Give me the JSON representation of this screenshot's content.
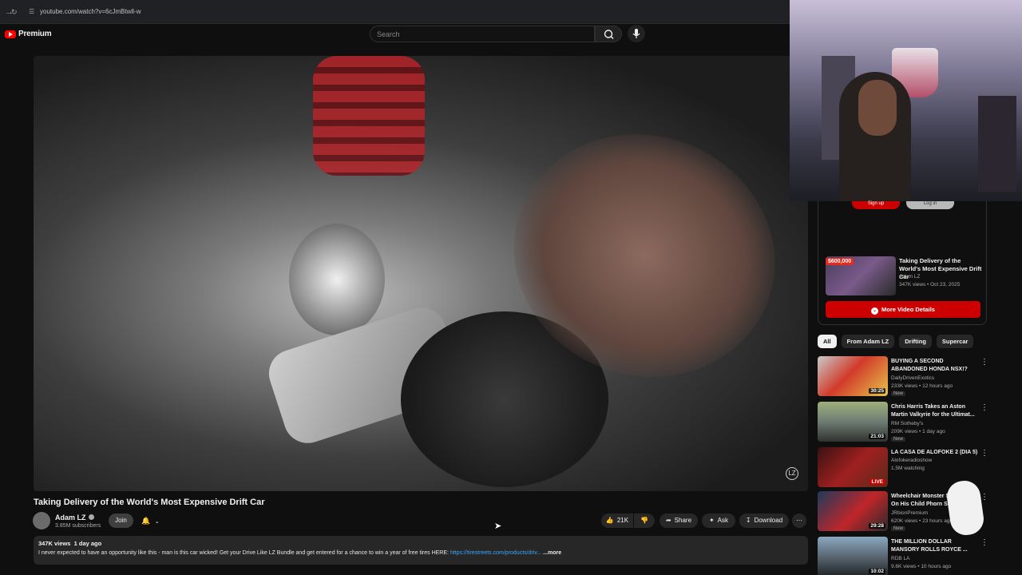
{
  "browser": {
    "url": "youtube.com/watch?v=6cJmBtwll-w"
  },
  "header": {
    "logo_text": "Premium",
    "search_placeholder": "Search"
  },
  "video": {
    "title": "Taking Delivery of the World's Most Expensive Drift Car",
    "watermark": "LZ"
  },
  "channel": {
    "name": "Adam LZ",
    "subscribers": "3.85M subscribers",
    "join_label": "Join"
  },
  "actions": {
    "likes": "21K",
    "share": "Share",
    "ask": "Ask",
    "download": "Download"
  },
  "description": {
    "views": "347K views",
    "age": "1 day ago",
    "text": "I never expected to have an opportunity like this - man is this car wicked! Get your Drive Like LZ Bundle and get entered for a chance to win a year of free tires HERE:",
    "link": "https://tirestreets.com/products/driv...",
    "more": "...more"
  },
  "panel": {
    "signup": "Sign up",
    "login": "Log in",
    "price_badge": "$600,000",
    "related_title": "Taking Delivery of the World's Most Expensive Drift Car",
    "related_channel": "Adam LZ",
    "related_meta": "347K views • Oct 23, 2025",
    "details_button": "More Video Details"
  },
  "chips": [
    "All",
    "From Adam LZ",
    "Drifting",
    "Supercar"
  ],
  "recommendations": [
    {
      "title1": "BUYING A SECOND",
      "title2": "ABANDONED HONDA NSX!?",
      "channel": "DailyDrivenExotics",
      "meta": "233K views • 12 hours ago",
      "badge": "New",
      "duration": "30:25"
    },
    {
      "title1": "Chris Harris Takes an Aston",
      "title2": "Martin Valkyrie for the Ultimat...",
      "channel": "RM Sotheby's",
      "meta": "209K views • 1 day ago",
      "badge": "New",
      "duration": "21:03"
    },
    {
      "title1": "LA CASA DE ALOFOKE 2 (DIA 5)",
      "title2": "",
      "channel": "Alofokeradioshow",
      "meta": "1.5M watching",
      "badge": "",
      "duration": "LIVE"
    },
    {
      "title1": "Wheelchair Monster S...",
      "title2": "On His Child Phorn Sur...",
      "channel": "JRbionPremium",
      "meta": "620K views • 23 hours ago",
      "badge": "New",
      "duration": "29:28"
    },
    {
      "title1": "THE MILLION DOLLAR",
      "title2": "MANSORY ROLLS ROYCE ...",
      "channel": "RDB LA",
      "meta": "9.6K views • 10 hours ago",
      "badge": "",
      "duration": "10:02"
    }
  ],
  "colors": {
    "brand_red": "#ff0000",
    "button_red": "#cc0000",
    "link_blue": "#3ea6ff",
    "background": "#0f0f0f"
  }
}
